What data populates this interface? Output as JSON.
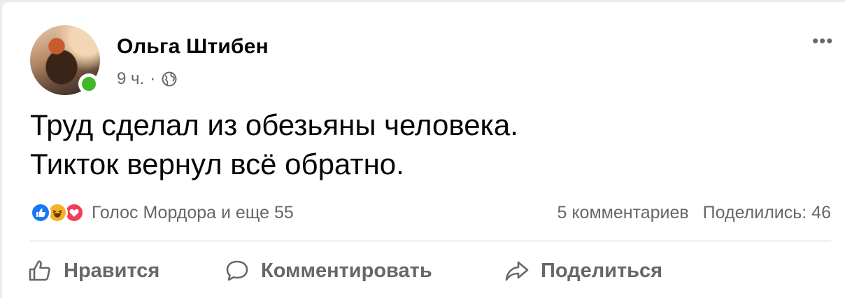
{
  "post": {
    "author": "Ольга Штибен",
    "time": "9 ч.",
    "separator": "·",
    "privacy_icon": "globe-icon",
    "lines": [
      "Труд сделал из обезьяны человека.",
      "Тикток вернул всё обратно."
    ]
  },
  "reactions": {
    "icons": [
      "like-reaction-icon",
      "haha-reaction-icon",
      "love-reaction-icon"
    ],
    "summary": "Голос Мордора и еще 55",
    "comments": "5 комментариев",
    "shares": "Поделились: 46"
  },
  "actions": {
    "like": "Нравится",
    "comment": "Комментировать",
    "share": "Поделиться"
  },
  "colors": {
    "online": "#42b72a",
    "like": "#1877f2",
    "haha": "#f7b125",
    "love": "#f33e58",
    "secondary_text": "#65676b"
  }
}
